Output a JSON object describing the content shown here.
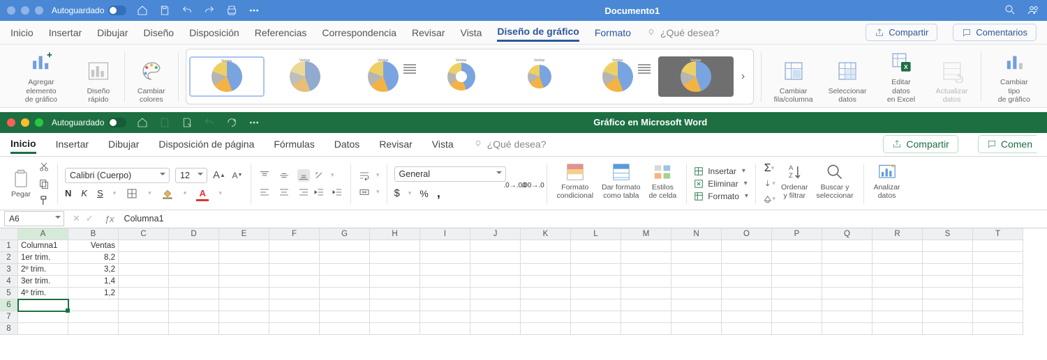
{
  "word": {
    "autosave": "Autoguardado",
    "title": "Documento1",
    "tabs": [
      "Inicio",
      "Insertar",
      "Dibujar",
      "Diseño",
      "Disposición",
      "Referencias",
      "Correspondencia",
      "Revisar",
      "Vista",
      "Diseño de gráfico",
      "Formato"
    ],
    "active_tab_index": 9,
    "secondary_blue_tab_index": 10,
    "tell_me": "¿Qué desea?",
    "share": "Compartir",
    "comments": "Comentarios",
    "ribbon": {
      "add_element": "Agregar elemento\nde gráfico",
      "quick_layout": "Diseño\nrápido",
      "change_colors": "Cambiar\ncolores",
      "switch_rc": "Cambiar\nfila/columna",
      "select_data": "Seleccionar\ndatos",
      "edit_excel": "Editar datos\nen Excel",
      "refresh": "Actualizar\ndatos",
      "change_type": "Cambiar tipo\nde gráfico"
    }
  },
  "excel": {
    "autosave": "Autoguardado",
    "title": "Gráfico en Microsoft Word",
    "tabs": [
      "Inicio",
      "Insertar",
      "Dibujar",
      "Disposición de página",
      "Fórmulas",
      "Datos",
      "Revisar",
      "Vista"
    ],
    "active_tab_index": 0,
    "tell_me": "¿Qué desea?",
    "share": "Compartir",
    "comments": "Comen",
    "ribbon": {
      "paste": "Pegar",
      "font_name": "Calibri (Cuerpo)",
      "font_size": "12",
      "number_format": "General",
      "cond_format": "Formato\ncondicional",
      "format_table": "Dar formato\ncomo tabla",
      "cell_styles": "Estilos\nde celda",
      "insert": "Insertar",
      "delete": "Eliminar",
      "format": "Formato",
      "sort_filter": "Ordenar\ny filtrar",
      "find_select": "Buscar y\nseleccionar",
      "analyze": "Analizar\ndatos"
    },
    "name_box": "A6",
    "formula_bar": "Columna1",
    "columns": [
      "A",
      "B",
      "C",
      "D",
      "E",
      "F",
      "G",
      "H",
      "I",
      "J",
      "K",
      "L",
      "M",
      "N",
      "O",
      "P",
      "Q",
      "R",
      "S",
      "T"
    ],
    "rows": [
      "1",
      "2",
      "3",
      "4",
      "5",
      "6",
      "7",
      "8"
    ],
    "data": {
      "A1": "Columna1",
      "B1": "Ventas",
      "A2": "1er trim.",
      "B2": "8,2",
      "A3": "2º trim.",
      "B3": "3,2",
      "A4": "3er trim.",
      "B4": "1,4",
      "A5": "4º trim.",
      "B5": "1,2"
    },
    "active_cell": "A6"
  },
  "chart_data": {
    "type": "pie",
    "title": "Ventas",
    "categories": [
      "1er trim.",
      "2º trim.",
      "3er trim.",
      "4º trim."
    ],
    "values": [
      8.2,
      3.2,
      1.4,
      1.2
    ],
    "series_name": "Ventas",
    "colors": [
      "#6f9fe0",
      "#f2b344",
      "#b5b5b5",
      "#eecf63"
    ]
  }
}
